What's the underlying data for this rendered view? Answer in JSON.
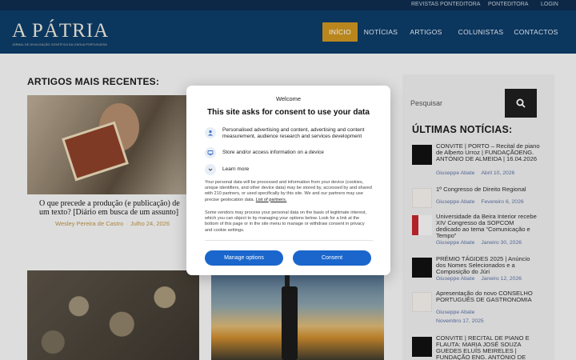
{
  "topbar": {
    "links": [
      "REVISTAS PONTEDITORA",
      "PONTEDITORA",
      "LOGIN"
    ]
  },
  "header": {
    "logo_title": "A PÁTRIA",
    "logo_tagline": "JORNAL DE DIVULGAÇÃO CIENTÍFICA DA LÍNGUA PORTUGUESA",
    "nav": [
      "INÍCIO",
      "NOTÍCIAS",
      "ARTIGOS",
      "COLUNISTAS",
      "CONTACTOS"
    ],
    "active_color": "#c8921f"
  },
  "main": {
    "heading": "ARTIGOS MAIS RECENTES:",
    "featured": {
      "title_line1": "O que precede a produção (e publicação) de",
      "title_line2": "um texto? [Diário em busca de um assunto]",
      "author": "Wesley Pereira de Castro",
      "date": "Julho 24, 2026"
    }
  },
  "sidebar": {
    "search_placeholder": "Pesquisar",
    "heading": "ÚLTIMAS NOTÍCIAS:",
    "news": [
      {
        "title": "CONVITE | PORTO – Recital de piano de Alberto Urroz | FUNDAÇÃOENG. ANTÓNIO DE ALMEIDA | 16.04.2026",
        "author": "Giuseppe Abate",
        "date": "Abril 10, 2026"
      },
      {
        "title": "1º Congresso de Direito Regional",
        "author": "Giuseppe Abate",
        "date": "Fevereiro 6, 2026"
      },
      {
        "title": "Universidade da Beira Interior recebe XIV Congresso da SOPCOM dedicado ao tema “Comunicação e Tempo”",
        "author": "Giuseppe Abate",
        "date": "Janeiro 30, 2026"
      },
      {
        "title": "PRÉMIO TÁGIDES 2025 | Anúncio dos Nomes Selecionados e a Composição do Júri",
        "author": "Giuseppe Abate",
        "date": "Janeiro 12, 2026"
      },
      {
        "title": "Apresentação do novo CONSELHO PORTUGUÊS DE GASTRONOMIA",
        "author": "Giuseppe Abate",
        "date": "Novembro 17, 2025"
      },
      {
        "title": "CONVITE | RECITAL DE PIANO E FLAUTA: MARIA JOSÉ SOUZA GUEDES ELUÍS MEIRELES | FUNDAÇÃO ENG. ANTÓNIO DE",
        "author": "",
        "date": ""
      }
    ]
  },
  "consent": {
    "brand": "Welcome",
    "title": "This site asks for consent to use your data",
    "purposes": [
      "Personalised advertising and content, advertising and content measurement, audience research and services development",
      "Store and/or access information on a device",
      "Learn more"
    ],
    "body1": "Your personal data will be processed and information from your device (cookies, unique identifiers, and other device data) may be stored by, accessed by and shared with 210 partners, or used specifically by this site. We and our partners may use precise geolocation data.",
    "partners_link": "List of partners.",
    "body2": "Some vendors may process your personal data on the basis of legitimate interest, which you can object to by managing your options below. Look for a link at the bottom of this page or in the site menu to manage or withdraw consent in privacy and cookie settings.",
    "manage_label": "Manage options",
    "consent_label": "Consent",
    "button_color": "#1a66cc"
  }
}
